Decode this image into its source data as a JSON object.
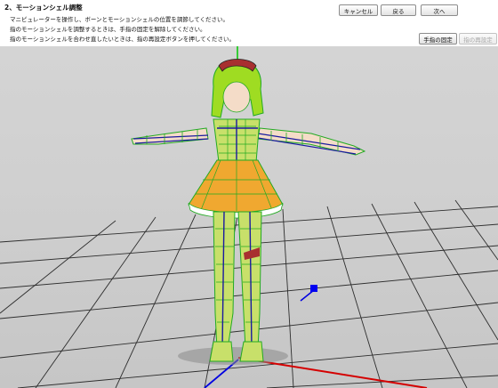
{
  "step": {
    "title": "2、モーションシェル調整",
    "instructions": [
      "マニピュレーターを操作し、ボーンとモーションシェルの位置を調節してください。",
      "指のモーションシェルを調整するときは、手指の固定を解除してください。",
      "指のモーションシェルを合わせ直したいときは、指の再設定ボタンを押してください。"
    ]
  },
  "buttons": {
    "cancel": "キャンセル",
    "back": "戻る",
    "next": "次へ",
    "fix_fingers": "手指の固定",
    "reset_fingers": "指の再設定"
  },
  "viewport": {
    "background": "#d0d0d0",
    "grid_color": "#333333",
    "axis_x_color": "#d40000",
    "axis_y_color": "#00c800",
    "axis_z_color": "#0000e0",
    "wireframe_color": "#22aa22",
    "bone_color": "#1a1aa0",
    "model_colors": {
      "hair": "#9fdc22",
      "skirt": "#f0a830",
      "skin": "#f4dcc8"
    }
  }
}
